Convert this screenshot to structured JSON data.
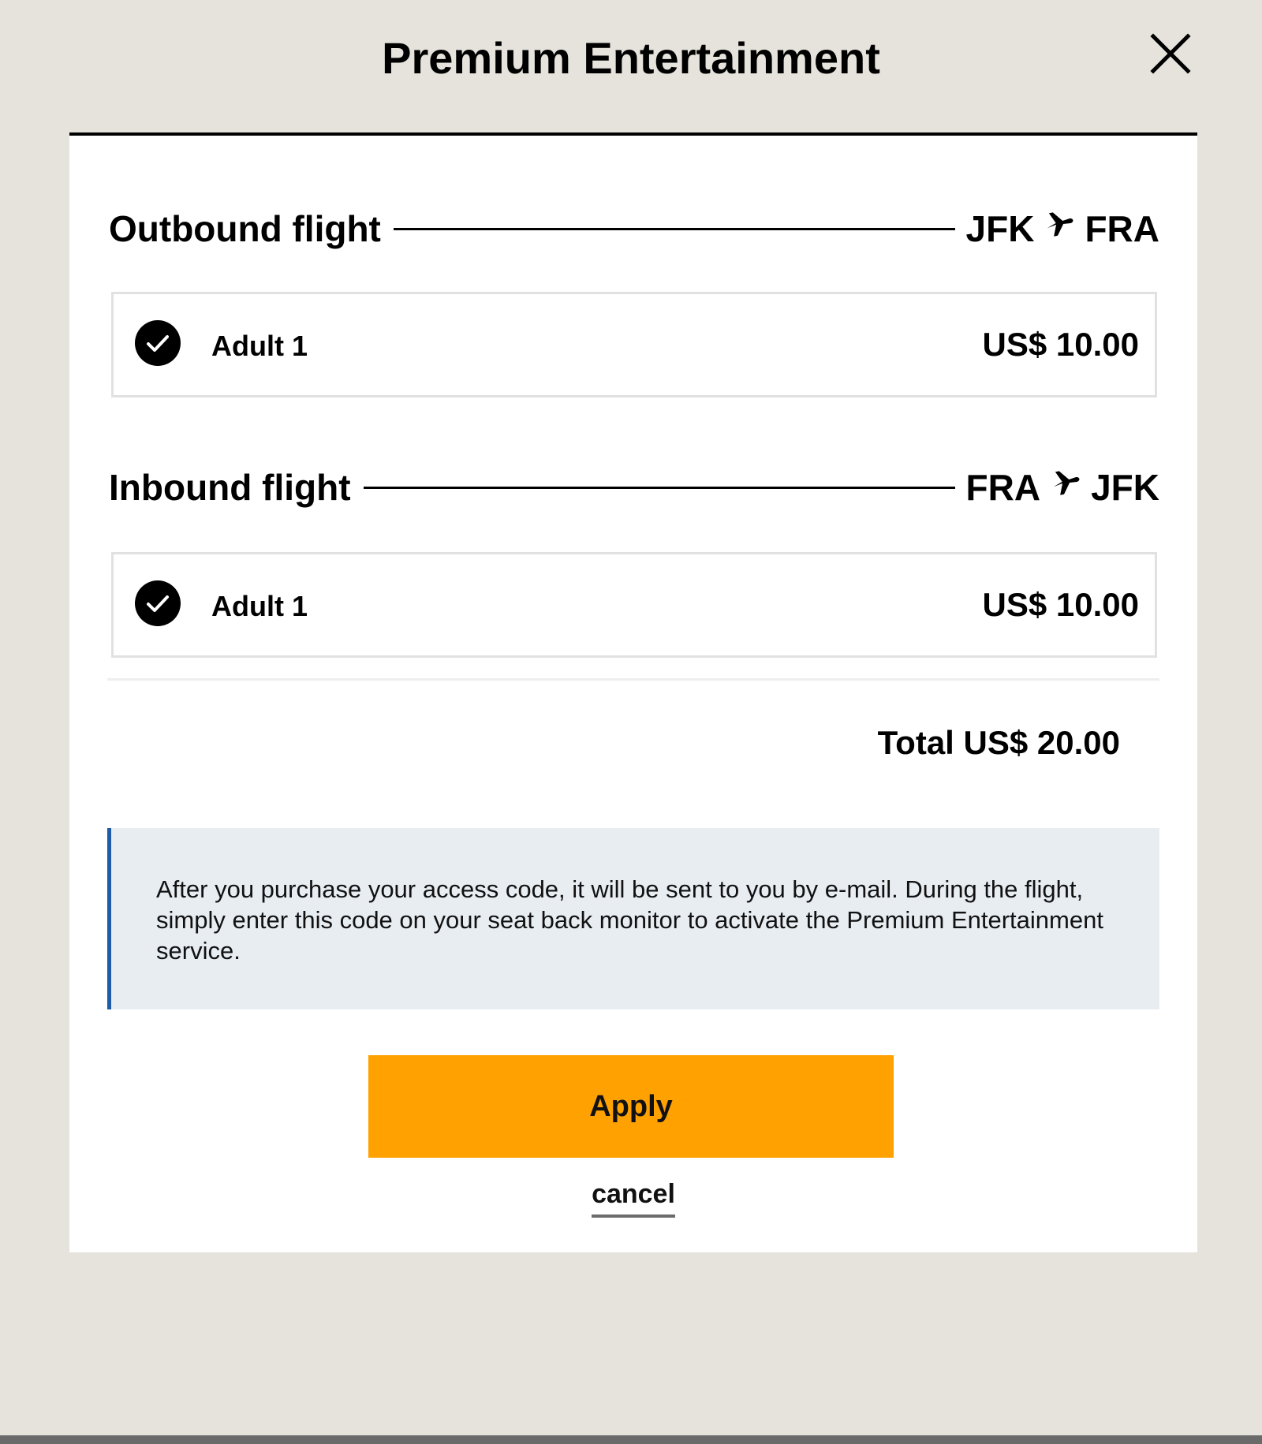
{
  "modal": {
    "title": "Premium Entertainment",
    "close_icon": "close-icon"
  },
  "flights": [
    {
      "title": "Outbound flight",
      "origin": "JFK",
      "destination": "FRA",
      "route_icon": "plane-icon",
      "passengers": [
        {
          "label": "Adult 1",
          "price": "US$ 10.00",
          "selected": true
        }
      ]
    },
    {
      "title": "Inbound flight",
      "origin": "FRA",
      "destination": "JFK",
      "route_icon": "plane-icon",
      "passengers": [
        {
          "label": "Adult 1",
          "price": "US$ 10.00",
          "selected": true
        }
      ]
    }
  ],
  "total": "Total US$ 20.00",
  "info": "After you purchase your access code, it will be sent to you by e-mail. During the flight, simply enter this code on your seat back monitor to activate the Premium Entertainment service.",
  "actions": {
    "apply_label": "Apply",
    "cancel_label": "cancel"
  },
  "colors": {
    "background": "#e6e3dc",
    "panel": "#ffffff",
    "apply_button": "#ffa100",
    "info_box": "#e8edf2",
    "info_accent": "#1f5ca8"
  }
}
